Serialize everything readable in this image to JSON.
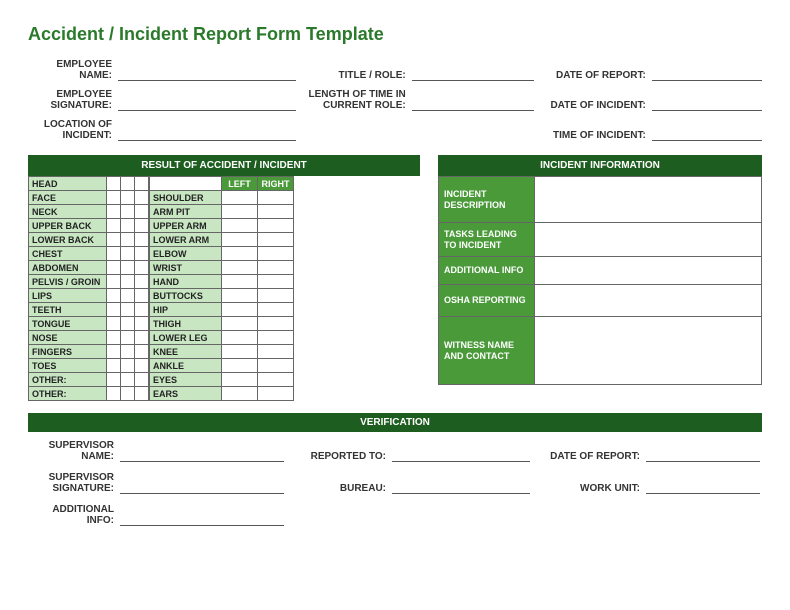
{
  "title": "Accident / Incident Report Form Template",
  "top": {
    "employee_name": "EMPLOYEE NAME:",
    "title_role": "TITLE / ROLE:",
    "date_of_report": "DATE OF REPORT:",
    "employee_signature": "EMPLOYEE SIGNATURE:",
    "length_in_role": "LENGTH OF TIME IN CURRENT ROLE:",
    "date_of_incident": "DATE OF INCIDENT:",
    "location_of_incident": "LOCATION OF INCIDENT:",
    "time_of_incident": "TIME OF INCIDENT:"
  },
  "result_header": "RESULT OF ACCIDENT / INCIDENT",
  "lr": {
    "left": "LEFT",
    "right": "RIGHT"
  },
  "parts_a": [
    "HEAD",
    "FACE",
    "NECK",
    "UPPER BACK",
    "LOWER BACK",
    "CHEST",
    "ABDOMEN",
    "PELVIS / GROIN",
    "LIPS",
    "TEETH",
    "TONGUE",
    "NOSE",
    "FINGERS",
    "TOES",
    "OTHER:",
    "OTHER:"
  ],
  "parts_b": [
    "SHOULDER",
    "ARM PIT",
    "UPPER ARM",
    "LOWER ARM",
    "ELBOW",
    "WRIST",
    "HAND",
    "BUTTOCKS",
    "HIP",
    "THIGH",
    "LOWER LEG",
    "KNEE",
    "ANKLE",
    "EYES",
    "EARS"
  ],
  "info_header": "INCIDENT INFORMATION",
  "info": {
    "desc": "INCIDENT DESCRIPTION",
    "tasks": "TASKS LEADING TO INCIDENT",
    "addl": "ADDITIONAL INFO",
    "osha": "OSHA REPORTING",
    "witness": "WITNESS NAME AND CONTACT"
  },
  "verify_header": "VERIFICATION",
  "verify": {
    "supervisor_name": "SUPERVISOR NAME:",
    "reported_to": "REPORTED TO:",
    "date_of_report": "DATE OF REPORT:",
    "supervisor_signature": "SUPERVISOR SIGNATURE:",
    "bureau": "BUREAU:",
    "work_unit": "WORK UNIT:",
    "additional_info": "ADDITIONAL INFO:"
  }
}
